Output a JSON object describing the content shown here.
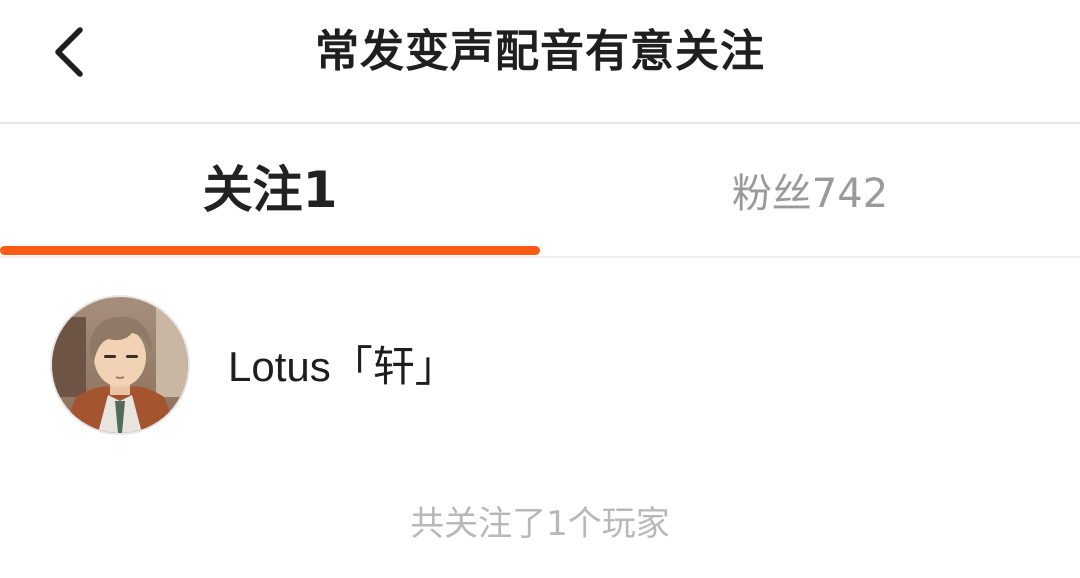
{
  "header": {
    "title": "常发变声配音有意关注",
    "back_icon": "chevron-left-icon"
  },
  "tabs": [
    {
      "label": "关注1",
      "active": true
    },
    {
      "label": "粉丝742",
      "active": false
    }
  ],
  "colors": {
    "accent": "#ff5a14",
    "text_primary": "#1e1e1e",
    "text_secondary": "#9a9a9a",
    "text_muted": "#b8b8b8"
  },
  "list": [
    {
      "name": "Lotus「轩」",
      "avatar": "user-avatar-anime-boy"
    }
  ],
  "footer": {
    "count_text": "共关注了1个玩家"
  }
}
